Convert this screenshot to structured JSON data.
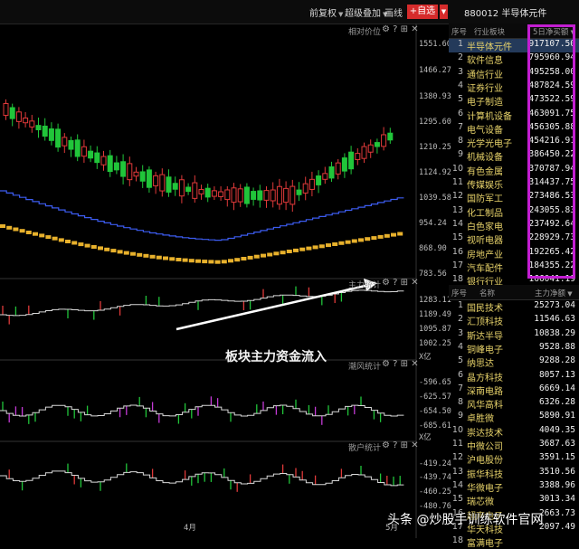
{
  "toolbar": {
    "qianfuquan": "前复权",
    "chaoji": "超级叠加",
    "huaxian": "画线",
    "add_watch": "+自选",
    "stock_title": "880012 半导体元件"
  },
  "panes": {
    "price": {
      "title": "相对价位",
      "axis": [
        "1551.60",
        "1466.27",
        "1380.93",
        "1295.60",
        "1210.25",
        "1124.92",
        "1039.58",
        "954.24",
        "868.90",
        "783.56"
      ]
    },
    "main_flow": {
      "title": "主力统计",
      "axis": [
        "1283.11",
        "1189.49",
        "1095.87",
        "1002.25",
        "X亿"
      ]
    },
    "chaofeng": {
      "title": "潮风统计",
      "axis": [
        "-596.65",
        "-625.57",
        "-654.50",
        "-685.61",
        "X亿"
      ]
    },
    "sanhu": {
      "title": "散户统计",
      "axis": [
        "-419.24",
        "-439.74",
        "-460.25",
        "-480.76"
      ]
    }
  },
  "annotation": "板块主力资金流入",
  "months": [
    "4月",
    "5月"
  ],
  "sector_table": {
    "headers": {
      "idx": "序号",
      "name": "行业板块",
      "value": "5日净买额"
    },
    "rows": [
      {
        "idx": "1",
        "name": "半导体元件",
        "value": "917107.50"
      },
      {
        "idx": "2",
        "name": "软件信息",
        "value": "795960.94"
      },
      {
        "idx": "3",
        "name": "通信行业",
        "value": "495258.00"
      },
      {
        "idx": "4",
        "name": "证券行业",
        "value": "487824.59"
      },
      {
        "idx": "5",
        "name": "电子制造",
        "value": "473522.59"
      },
      {
        "idx": "6",
        "name": "计算机设备",
        "value": "463091.75"
      },
      {
        "idx": "7",
        "name": "电气设备",
        "value": "456305.88"
      },
      {
        "idx": "8",
        "name": "光学光电子",
        "value": "454216.91"
      },
      {
        "idx": "9",
        "name": "机械设备",
        "value": "386450.22"
      },
      {
        "idx": "10",
        "name": "有色金属",
        "value": "370787.94"
      },
      {
        "idx": "11",
        "name": "传媒娱乐",
        "value": "314437.75"
      },
      {
        "idx": "12",
        "name": "国防军工",
        "value": "273486.53"
      },
      {
        "idx": "13",
        "name": "化工制品",
        "value": "243055.83"
      },
      {
        "idx": "14",
        "name": "白色家电",
        "value": "237492.64"
      },
      {
        "idx": "15",
        "name": "视听电器",
        "value": "228929.73"
      },
      {
        "idx": "16",
        "name": "房地产业",
        "value": "192265.42"
      },
      {
        "idx": "17",
        "name": "汽车配件",
        "value": "184355.22"
      },
      {
        "idx": "18",
        "name": "银行行业",
        "value": "166041.19"
      }
    ]
  },
  "stock_table": {
    "headers": {
      "idx": "序号",
      "name": "名称",
      "value": "主力净额"
    },
    "rows": [
      {
        "idx": "1",
        "name": "国民技术",
        "value": "25273.04"
      },
      {
        "idx": "2",
        "name": "汇顶科技",
        "value": "11546.63"
      },
      {
        "idx": "3",
        "name": "斯达半导",
        "value": "10838.29"
      },
      {
        "idx": "4",
        "name": "铜峰电子",
        "value": "9528.88"
      },
      {
        "idx": "5",
        "name": "纳思达",
        "value": "9288.28"
      },
      {
        "idx": "6",
        "name": "晶方科技",
        "value": "8057.13"
      },
      {
        "idx": "7",
        "name": "深南电路",
        "value": "6669.14"
      },
      {
        "idx": "8",
        "name": "风华高科",
        "value": "6326.28"
      },
      {
        "idx": "9",
        "name": "卓胜微",
        "value": "5890.91"
      },
      {
        "idx": "10",
        "name": "崇达技术",
        "value": "4049.35"
      },
      {
        "idx": "11",
        "name": "中微公司",
        "value": "3687.63"
      },
      {
        "idx": "12",
        "name": "沪电股份",
        "value": "3591.15"
      },
      {
        "idx": "13",
        "name": "振华科技",
        "value": "3510.56"
      },
      {
        "idx": "14",
        "name": "华微电子",
        "value": "3388.96"
      },
      {
        "idx": "15",
        "name": "瑞芯微",
        "value": "3013.34"
      },
      {
        "idx": "16",
        "name": "超声电子",
        "value": "2663.73"
      },
      {
        "idx": "17",
        "name": "华天科技",
        "value": "2097.49"
      },
      {
        "idx": "18",
        "name": "富满电子",
        "value": ""
      }
    ]
  },
  "watermark": "头条 @炒股手训练软件官网",
  "colors": {
    "up": "#e03a3a",
    "down": "#21c53a",
    "accent_red": "#d62b2b",
    "highlight_box": "#c21ed1",
    "selected_row": "#243a5a",
    "line_blue": "#3c5cf0",
    "bar_gold": "#e8b12c"
  }
}
